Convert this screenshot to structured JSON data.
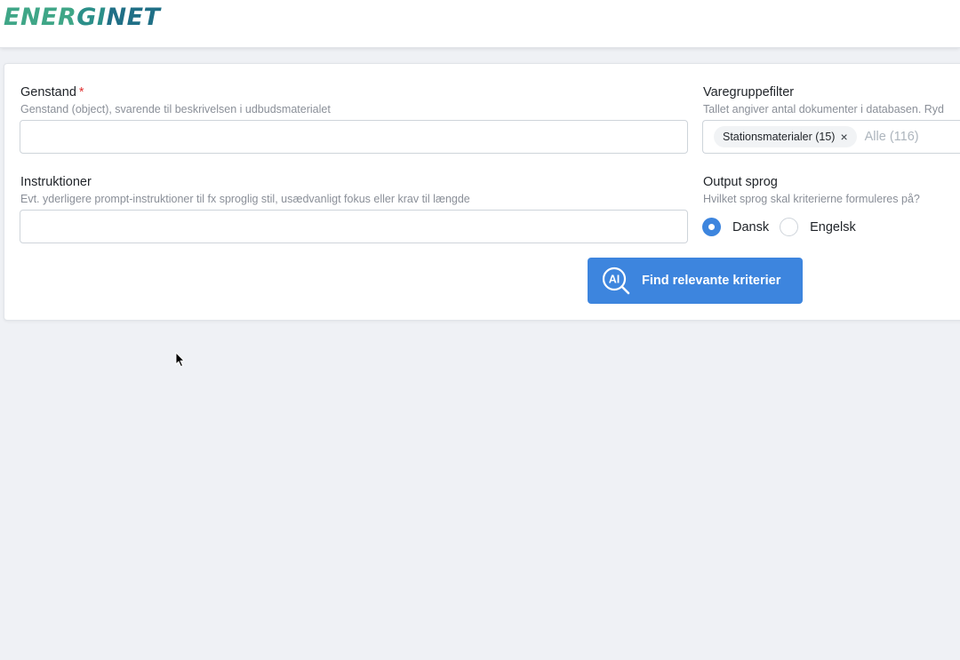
{
  "header": {
    "logo": {
      "part1": "ENER",
      "part2": "GI",
      "part3": "NET",
      "colors": [
        "#3fa687",
        "#2b8f89",
        "#1f6f86"
      ]
    }
  },
  "form": {
    "genstand": {
      "label": "Genstand",
      "required_mark": "*",
      "description": "Genstand (object), svarende til beskrivelsen i udbudsmaterialet",
      "value": ""
    },
    "instruktioner": {
      "label": "Instruktioner",
      "description": "Evt. yderligere prompt-instruktioner til fx sproglig stil, usædvanligt fokus eller krav til længde",
      "value": ""
    },
    "varegruppefilter": {
      "label": "Varegruppefilter",
      "description": "Tallet angiver antal dokumenter i databasen. Ryd",
      "selected": [
        {
          "label": "Stationsmaterialer (15)"
        }
      ],
      "remove_icon": "×",
      "placeholder": "Alle (116)"
    },
    "output_sprog": {
      "label": "Output sprog",
      "description": "Hvilket sprog skal kriterierne formuleres på?",
      "options": [
        {
          "label": "Dansk",
          "checked": true
        },
        {
          "label": "Engelsk",
          "checked": false
        }
      ]
    },
    "submit": {
      "label": "Find relevante kriterier",
      "icon": "ai-search-icon",
      "icon_text": "AI"
    }
  },
  "colors": {
    "accent": "#3d85de",
    "background": "#eff1f5",
    "required": "#e03131",
    "muted_text": "#8a8f98"
  }
}
